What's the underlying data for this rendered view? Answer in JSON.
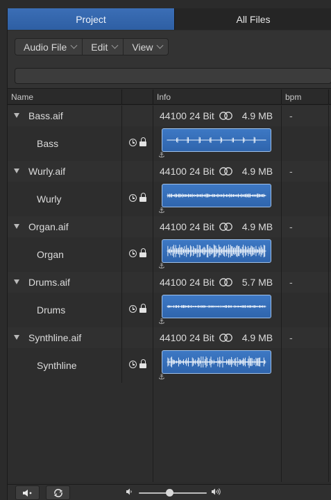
{
  "tabs": [
    {
      "label": "Project",
      "active": true
    },
    {
      "label": "All Files",
      "active": false
    }
  ],
  "toolbar": {
    "menus": [
      {
        "label": "Audio File"
      },
      {
        "label": "Edit"
      },
      {
        "label": "View"
      }
    ],
    "search_value": ""
  },
  "columns": {
    "name": "Name",
    "info": "Info",
    "bpm": "bpm"
  },
  "files": [
    {
      "file_name": "Bass.aif",
      "sample_rate": "44100",
      "bit_depth": "24 Bit",
      "size": "4.9 MB",
      "bpm": "-",
      "region_name": "Bass"
    },
    {
      "file_name": "Wurly.aif",
      "sample_rate": "44100",
      "bit_depth": "24 Bit",
      "size": "4.9 MB",
      "bpm": "-",
      "region_name": "Wurly"
    },
    {
      "file_name": "Organ.aif",
      "sample_rate": "44100",
      "bit_depth": "24 Bit",
      "size": "4.9 MB",
      "bpm": "-",
      "region_name": "Organ"
    },
    {
      "file_name": "Drums.aif",
      "sample_rate": "44100",
      "bit_depth": "24 Bit",
      "size": "5.7 MB",
      "bpm": "-",
      "region_name": "Drums"
    },
    {
      "file_name": "Synthline.aif",
      "sample_rate": "44100",
      "bit_depth": "24 Bit",
      "size": "4.9 MB",
      "bpm": "-",
      "region_name": "Synthline"
    }
  ],
  "icons": {
    "disclosure": "disclosure-triangle-icon",
    "stereo": "stereo-rings-icon",
    "clock": "clock-icon",
    "lock": "unlock-icon",
    "anchor": "anchor-icon",
    "speaker": "speaker-icon",
    "loop": "loop-icon",
    "volume_low": "volume-low-icon",
    "volume_high": "volume-high-icon"
  },
  "colors": {
    "accent": "#3b6eb6",
    "waveform_fill": "#3d78c4",
    "waveform_border": "#9fc1ea"
  },
  "volume_level": 0.45
}
